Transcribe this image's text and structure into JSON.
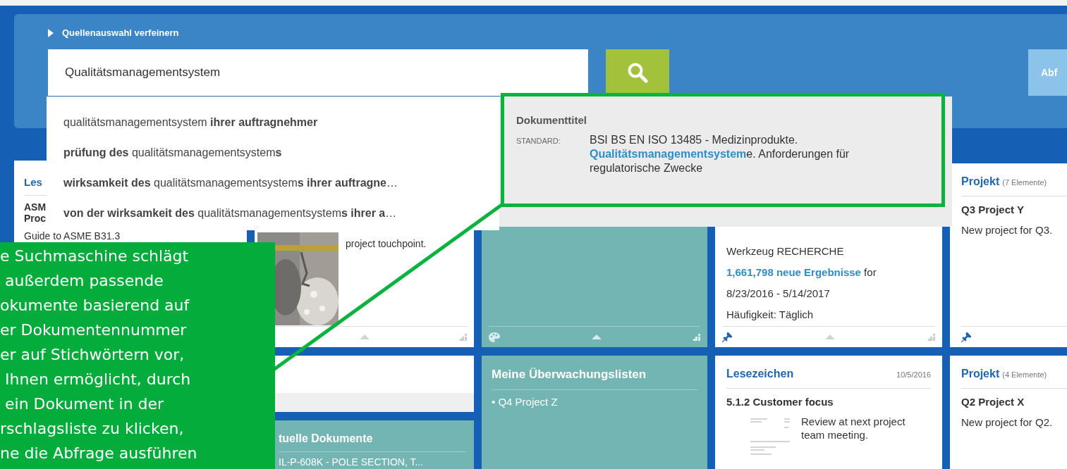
{
  "refine_link": {
    "label": "Quellenauswahl verfeinern"
  },
  "search": {
    "value": "Qualitätsmanagementsystem"
  },
  "query_button": {
    "label": "Abf"
  },
  "suggestions": [
    {
      "text": "qualitätsmanagementsystem **ihrer auftragnehmer**"
    },
    {
      "text": "**prüfung des** qualitätsmanagementsystem**s**"
    },
    {
      "text": "**wirksamkeit des** qualitätsmanagementsystem**s ihrer auftragne**…"
    },
    {
      "text": "**von der wirksamkeit des** qualitätsmanagementsystem**s ihrer a**…"
    }
  ],
  "suggestion_tooltip": {
    "heading": "Dokumenttitel",
    "type_label": "STANDARD:",
    "title_parts": [
      {
        "text": "BSI BS EN ISO 13485 - Medizinprodukte. ",
        "highlight": false
      },
      {
        "text": "Qualitätsmanagementsystem",
        "highlight": true
      },
      {
        "text": "e. Anforderungen für regulatorische Zwecke",
        "highlight": false
      }
    ]
  },
  "reading_list_card": {
    "title": "Les",
    "lines": [
      "ASM",
      "Proc",
      "Guide to ASME B31.3"
    ]
  },
  "image_note_card": {
    "note": "project touchpoint."
  },
  "alert_card": {
    "tool": "Werkzeug RECHERCHE",
    "results": "1,661,798 neue Ergebnisse",
    "results_suffix": "for",
    "date_range": "8/23/2016 - 5/14/2017",
    "frequency": "Häufigkeit: Täglich"
  },
  "project_cards": [
    {
      "label": "Projekt",
      "count": "(7 Elemente)",
      "name": "Q3 Project Y",
      "description": "New project for Q3."
    },
    {
      "label": "Projekt",
      "count": "(4 Elemente)",
      "name": "Q2 Project X",
      "description": "New project for Q2."
    }
  ],
  "watchlists": {
    "title": "Meine Überwachungslisten",
    "items": [
      "• Q4 Project Z"
    ]
  },
  "bookmark": {
    "label": "Lesezeichen",
    "date": "10/5/2016",
    "title": "5.1.2 Customer focus",
    "note": "Review at next project team meeting."
  },
  "recent_documents": {
    "title": "tuelle Dokumente",
    "items": [
      "IL-P-608K - POLE SECTION, T..."
    ]
  },
  "callout": {
    "lines": [
      "e Suchmaschine schlägt",
      " außerdem passende",
      "okumente basierend auf",
      "er Dokumentennummer",
      "er auf Stichwörtern vor,",
      " Ihnen ermöglicht, durch",
      " ein Dokument in der",
      "rschlagsliste zu klicken,",
      "ne die Abfrage ausführen"
    ]
  }
}
